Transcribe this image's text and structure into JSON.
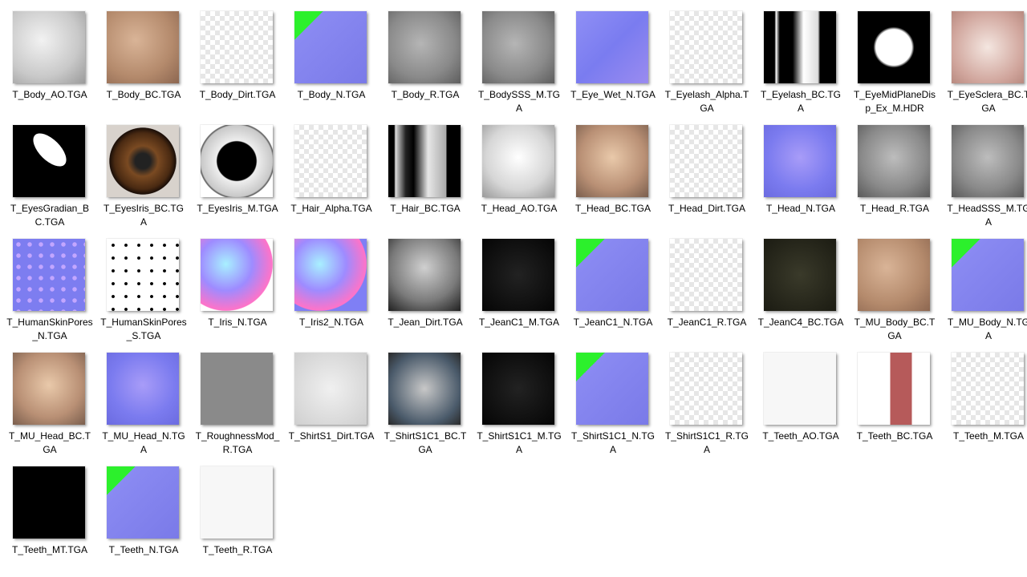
{
  "files": [
    {
      "name": "T_Body_AO.TGA",
      "thumb": "t-ao"
    },
    {
      "name": "T_Body_BC.TGA",
      "thumb": "t-skin"
    },
    {
      "name": "T_Body_Dirt.TGA",
      "thumb": "checker"
    },
    {
      "name": "T_Body_N.TGA",
      "thumb": "t-greenish"
    },
    {
      "name": "T_Body_R.TGA",
      "thumb": "t-gray"
    },
    {
      "name": "T_BodySSS_M.TGA",
      "thumb": "t-gray"
    },
    {
      "name": "T_Eye_Wet_N.TGA",
      "thumb": "t-normal"
    },
    {
      "name": "T_Eyelash_Alpha.TGA",
      "thumb": "checker"
    },
    {
      "name": "T_Eyelash_BC.TGA",
      "thumb": "t-eyelashbc"
    },
    {
      "name": "T_EyeMidPlaneDisp_Ex_M.HDR",
      "thumb": "t-ring"
    },
    {
      "name": "T_EyeSclera_BC.TGA",
      "thumb": "t-sclera"
    },
    {
      "name": "T_EyesGradian_BC.TGA",
      "thumb": "t-eyegrad"
    },
    {
      "name": "T_EyesIris_BC.TGA",
      "thumb": "t-iris"
    },
    {
      "name": "T_EyesIris_M.TGA",
      "thumb": "t-irism"
    },
    {
      "name": "T_Hair_Alpha.TGA",
      "thumb": "checker"
    },
    {
      "name": "T_Hair_BC.TGA",
      "thumb": "t-hairbc"
    },
    {
      "name": "T_Head_AO.TGA",
      "thumb": "t-headao"
    },
    {
      "name": "T_Head_BC.TGA",
      "thumb": "t-head"
    },
    {
      "name": "T_Head_Dirt.TGA",
      "thumb": "checker"
    },
    {
      "name": "T_Head_N.TGA",
      "thumb": "t-headn"
    },
    {
      "name": "T_Head_R.TGA",
      "thumb": "t-headr"
    },
    {
      "name": "T_HeadSSS_M.TGA",
      "thumb": "t-headr"
    },
    {
      "name": "T_HumanSkinPores_N.TGA",
      "thumb": "t-pores"
    },
    {
      "name": "T_HumanSkinPores_S.TGA",
      "thumb": "t-dots"
    },
    {
      "name": "T_Iris_N.TGA",
      "thumb": "t-sphere"
    },
    {
      "name": "T_Iris2_N.TGA",
      "thumb": "t-sphere2"
    },
    {
      "name": "T_Jean_Dirt.TGA",
      "thumb": "t-jean"
    },
    {
      "name": "T_JeanC1_M.TGA",
      "thumb": "t-darkgray"
    },
    {
      "name": "T_JeanC1_N.TGA",
      "thumb": "t-greenish"
    },
    {
      "name": "T_JeanC1_R.TGA",
      "thumb": "checker"
    },
    {
      "name": "T_JeanC4_BC.TGA",
      "thumb": "t-jeanc4"
    },
    {
      "name": "T_MU_Body_BC.TGA",
      "thumb": "t-skin"
    },
    {
      "name": "T_MU_Body_N.TGA",
      "thumb": "t-greenish"
    },
    {
      "name": "T_MU_Head_BC.TGA",
      "thumb": "t-head"
    },
    {
      "name": "T_MU_Head_N.TGA",
      "thumb": "t-headn"
    },
    {
      "name": "T_RoughnessMod_R.TGA",
      "thumb": "t-flat"
    },
    {
      "name": "T_ShirtS1_Dirt.TGA",
      "thumb": "t-light"
    },
    {
      "name": "T_ShirtS1C1_BC.TGA",
      "thumb": "t-shirtbc"
    },
    {
      "name": "T_ShirtS1C1_M.TGA",
      "thumb": "t-darkgray"
    },
    {
      "name": "T_ShirtS1C1_N.TGA",
      "thumb": "t-greenish"
    },
    {
      "name": "T_ShirtS1C1_R.TGA",
      "thumb": "checker"
    },
    {
      "name": "T_Teeth_AO.TGA",
      "thumb": "t-white"
    },
    {
      "name": "T_Teeth_BC.TGA",
      "thumb": "t-teethbc"
    },
    {
      "name": "T_Teeth_M.TGA",
      "thumb": "checker"
    },
    {
      "name": "T_Teeth_MT.TGA",
      "thumb": "t-black"
    },
    {
      "name": "T_Teeth_N.TGA",
      "thumb": "t-greenish"
    },
    {
      "name": "T_Teeth_R.TGA",
      "thumb": "t-white"
    }
  ],
  "wrap": {
    "T_Body_AO.TGA": [
      "T_Body_AO.TGA"
    ],
    "T_EyeMidPlaneDisp_Ex_M.HDR": [
      "T_EyeMidPlaneDi",
      "sp_Ex_M.HDR"
    ]
  }
}
